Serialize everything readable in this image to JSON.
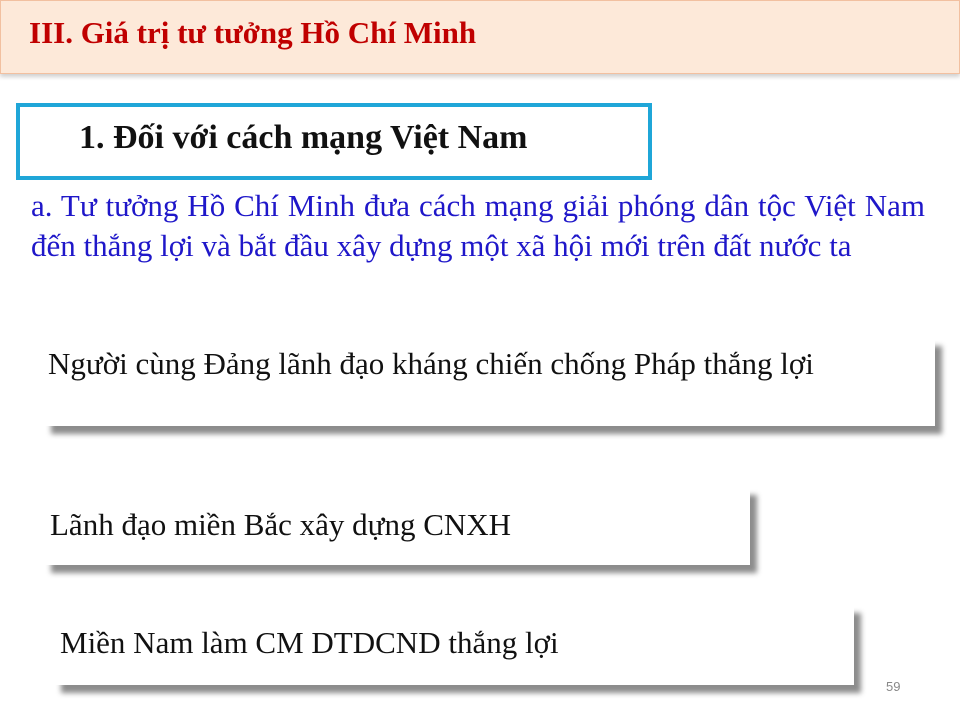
{
  "slide": {
    "title": "III. Giá trị tư tưởng Hồ Chí Minh",
    "section_heading": "1. Đối với cách mạng Việt Nam",
    "intro": "a. Tư tưởng Hồ Chí Minh đưa cách mạng giải phóng dân tộc Việt Nam đến thắng lợi và bắt đầu xây dựng một xã hội mới trên đất nước ta",
    "points": [
      "Người cùng Đảng lãnh đạo kháng chiến chống Pháp thắng lợi",
      "Lãnh đạo miền Bắc xây dựng CNXH",
      "Miền Nam làm CM DTDCND thắng lợi"
    ],
    "page_number": "59"
  },
  "colors": {
    "title_bar_bg": "#fde9d9",
    "title_text": "#c00000",
    "section_border": "#1fa6d8",
    "intro_text": "#1f17c9"
  }
}
